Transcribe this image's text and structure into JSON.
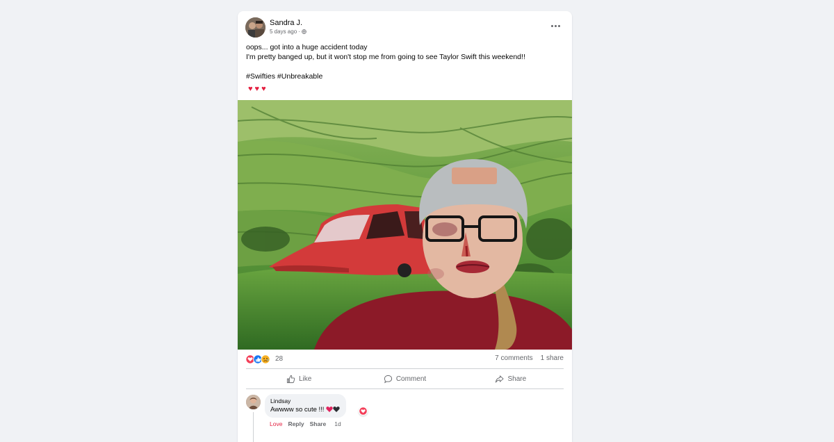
{
  "post": {
    "author": "Sandra J.",
    "time": "5 days ago",
    "privacy_icon": "globe-icon",
    "text_line1": "oops... got into a huge accident today",
    "text_line2": "I'm pretty banged up, but it won't stop me from going to see Taylor Swift this weekend!!",
    "hashtags": "#Swifties #Unbreakable",
    "emoji": "♥♥♥",
    "photo_icon": "selfie-with-wrecked-red-car-photo"
  },
  "stats": {
    "reaction_icons": [
      "love-reaction-icon",
      "like-reaction-icon",
      "sad-reaction-icon"
    ],
    "reaction_count": "28",
    "comments": "7 comments",
    "shares": "1 share"
  },
  "actions": {
    "like": "Like",
    "comment": "Comment",
    "share": "Share"
  },
  "comment": {
    "name": "Lindsay",
    "text": "Awwww so cute !!!",
    "text_emoji": [
      "red-heart",
      "black-heart"
    ],
    "reaction": "love-reaction-icon",
    "love_label": "Love",
    "reply_label": "Reply",
    "share_label": "Share",
    "time": "1d"
  },
  "colors": {
    "background": "#f0f2f5",
    "card": "#ffffff",
    "secondary_text": "#65676b",
    "love_red": "#e41e3f",
    "like_blue": "#1877f2"
  }
}
